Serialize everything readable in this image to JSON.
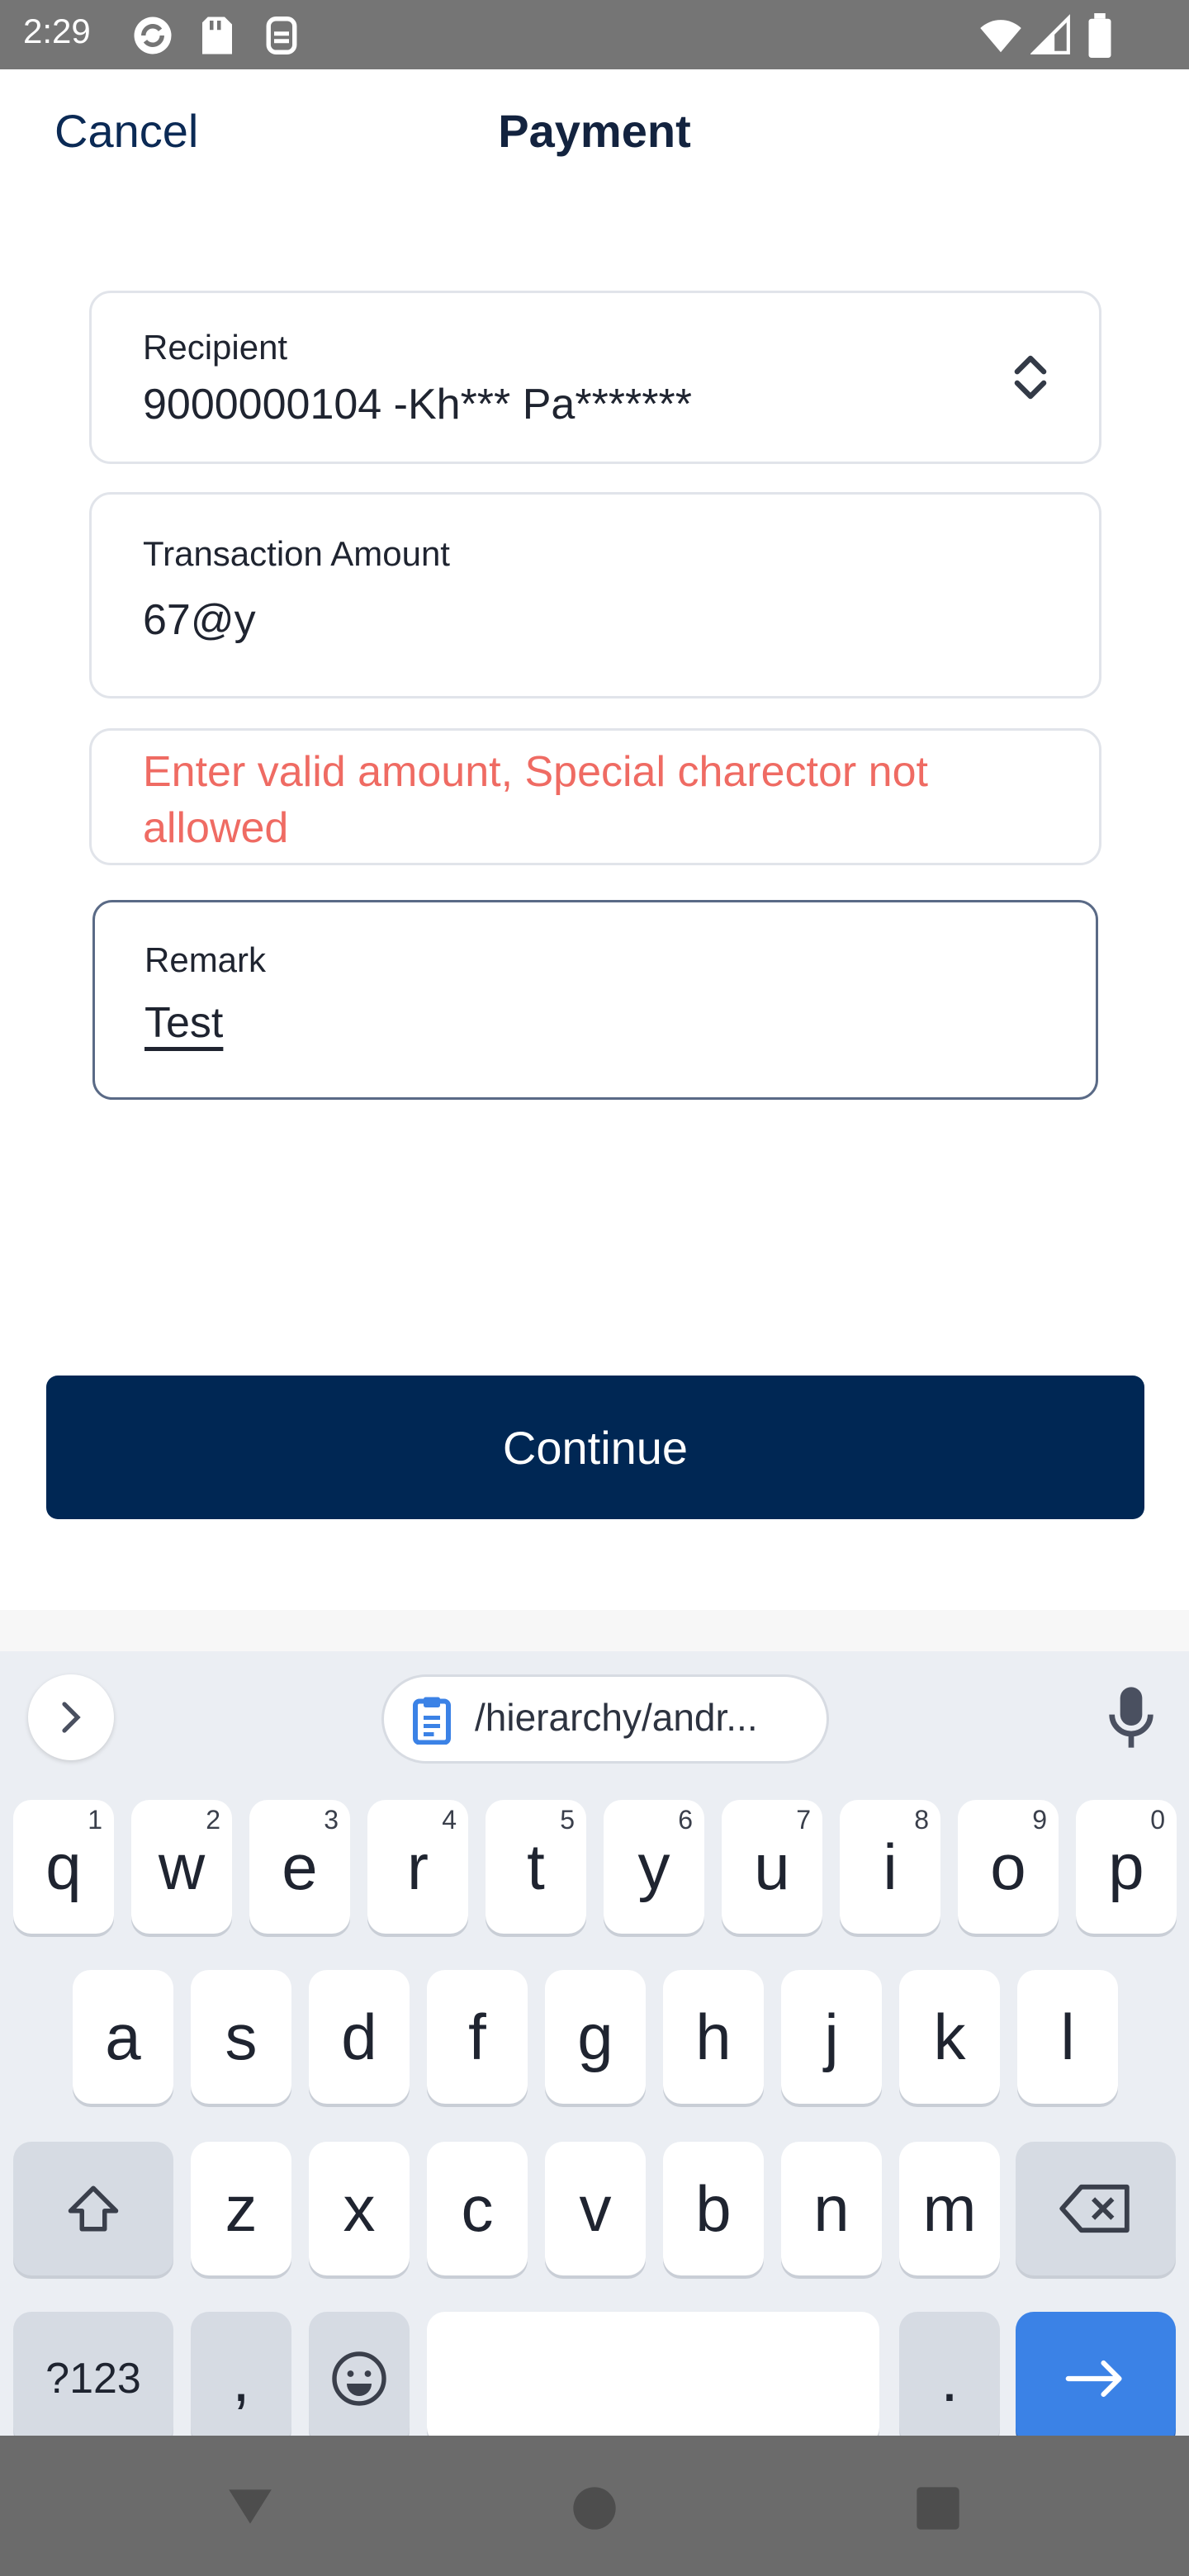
{
  "status_bar": {
    "time": "2:29",
    "left_icons": [
      "sync-icon",
      "sd-card-icon",
      "vpn-icon"
    ],
    "right_icons": [
      "wifi-icon",
      "signal-icon",
      "battery-icon"
    ]
  },
  "header": {
    "cancel_label": "Cancel",
    "title": "Payment"
  },
  "form": {
    "recipient": {
      "label": "Recipient",
      "value": "9000000104 -Kh*** Pa*******"
    },
    "amount": {
      "label": "Transaction Amount",
      "value": "67@y"
    },
    "error_message": "Enter valid amount, Special charector not allowed",
    "remark": {
      "label": "Remark",
      "value": "Test"
    }
  },
  "continue_label": "Continue",
  "keyboard": {
    "clipboard_chip": "/hierarchy/andr...",
    "row1": [
      {
        "k": "q",
        "h": "1"
      },
      {
        "k": "w",
        "h": "2"
      },
      {
        "k": "e",
        "h": "3"
      },
      {
        "k": "r",
        "h": "4"
      },
      {
        "k": "t",
        "h": "5"
      },
      {
        "k": "y",
        "h": "6"
      },
      {
        "k": "u",
        "h": "7"
      },
      {
        "k": "i",
        "h": "8"
      },
      {
        "k": "o",
        "h": "9"
      },
      {
        "k": "p",
        "h": "0"
      }
    ],
    "row2": [
      "a",
      "s",
      "d",
      "f",
      "g",
      "h",
      "j",
      "k",
      "l"
    ],
    "row3": [
      "z",
      "x",
      "c",
      "v",
      "b",
      "n",
      "m"
    ],
    "symbols_label": "?123",
    "comma_label": ",",
    "period_label": "."
  },
  "colors": {
    "primary": "#002754",
    "error": "#ef6b63",
    "keyboard_action": "#3b82e6"
  }
}
